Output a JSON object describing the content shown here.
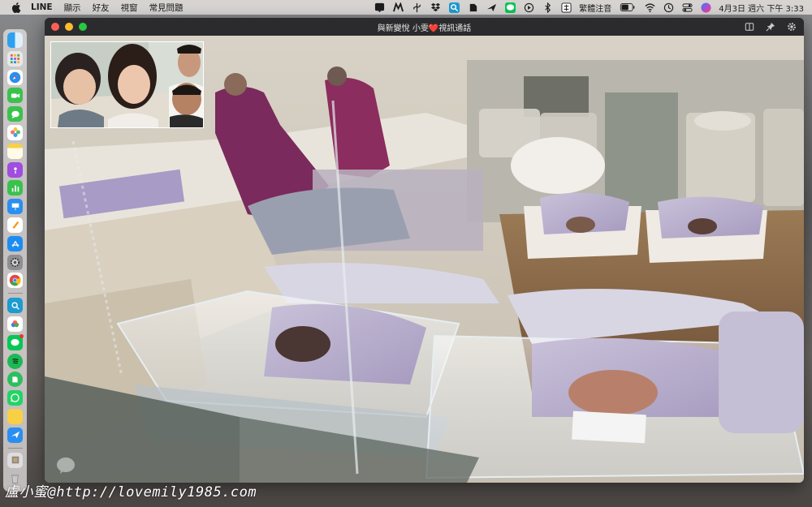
{
  "menubar": {
    "apple_icon": "apple-icon",
    "app_name": "LINE",
    "menus": [
      "顯示",
      "好友",
      "視窗",
      "常見問題"
    ],
    "ime_label": "繁體注音",
    "clock": "4月3日 週六 下午 3:33",
    "status_icons": [
      "line-status-icon",
      "m-icon",
      "usb-icon",
      "dropbox-icon",
      "search-app-icon",
      "evernote-icon",
      "bird-icon",
      "line-icon",
      "play-icon",
      "bluetooth-icon",
      "ime-icon",
      "battery-icon",
      "wifi-icon",
      "history-icon",
      "control-center-icon",
      "siri-icon"
    ]
  },
  "dock": {
    "items": [
      "finder-icon",
      "launchpad-icon",
      "safari-icon",
      "facetime-icon",
      "messages-icon",
      "photos-icon",
      "notes-icon",
      "podcasts-icon",
      "numbers-icon",
      "keynote-icon",
      "pages-icon",
      "app-store-icon",
      "settings-icon",
      "chrome-icon",
      "search-icon",
      "cloud-icon",
      "line-icon",
      "spotify-icon",
      "evernote-icon",
      "whatsapp-icon",
      "stickies-icon",
      "bird-icon",
      "preview-icon",
      "trash-icon"
    ]
  },
  "window": {
    "title": "與新變悅 小雯❤️視訊通話",
    "tools": [
      "sidebar-icon",
      "pin-icon",
      "gear-icon"
    ]
  },
  "credit": "盧小蜜@http://lovemily1985.com",
  "colors": {
    "menubar_bg": "#d6d3d1",
    "titlebar_bg": "#2b2b2d",
    "close": "#fd5e57",
    "minimize": "#febc2e",
    "maximize": "#28c840"
  }
}
